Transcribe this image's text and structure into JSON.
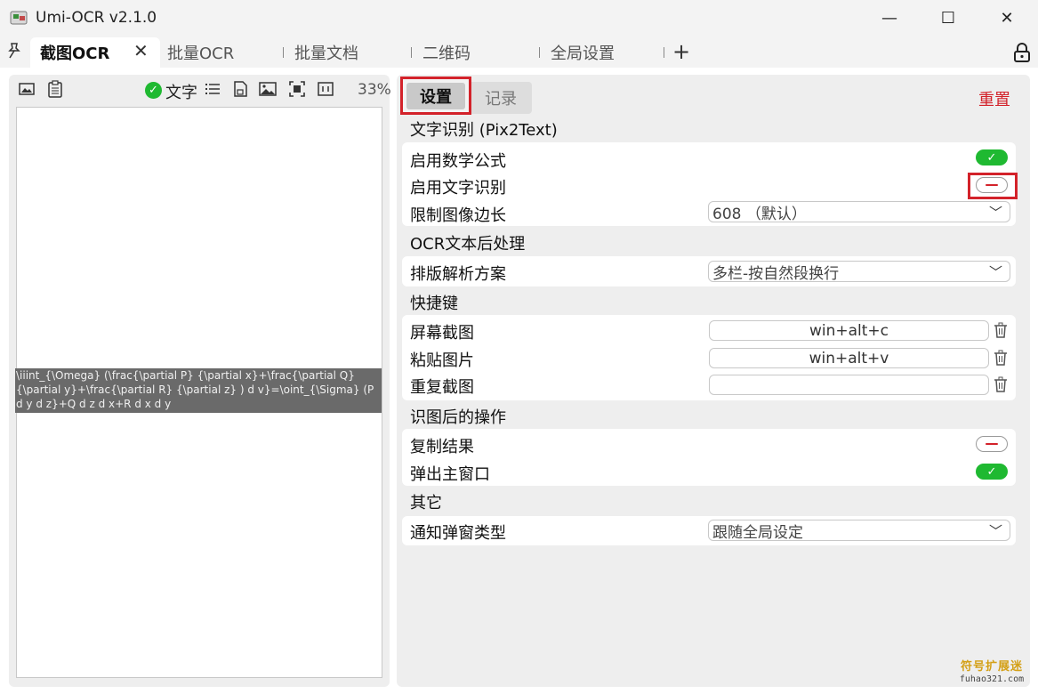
{
  "window": {
    "title": "Umi-OCR v2.1.0",
    "minimize": "—",
    "maximize": "☐",
    "close": "✕"
  },
  "tabs": [
    {
      "label": "截图OCR"
    },
    {
      "label": "批量OCR"
    },
    {
      "label": "批量文档"
    },
    {
      "label": "二维码"
    },
    {
      "label": "全局设置"
    }
  ],
  "tab_close": "✕",
  "tab_add": "+",
  "left": {
    "text_toggle_label": "文字",
    "zoom": "33%",
    "ocr_result": "\\iiint_{\\Omega} (\\frac{\\partial P} {\\partial x}+\\frac{\\partial Q} {\\partial y}+\\frac{\\partial R} {\\partial z} ) d v}=\\oint_{\\Sigma} (P d y d z}+Q d z d x+R d x d y"
  },
  "right": {
    "seg_settings": "设置",
    "seg_log": "记录",
    "reset": "重置",
    "sections": {
      "text_recog": "文字识别 (Pix2Text)",
      "postprocess": "OCR文本后处理",
      "hotkeys": "快捷键",
      "after_ocr": "识图后的操作",
      "other": "其它"
    },
    "rows": {
      "enable_math": "启用数学公式",
      "enable_text": "启用文字识别",
      "limit_size": "限制图像边长",
      "limit_size_value": "608 （默认）",
      "layout_scheme": "排版解析方案",
      "layout_scheme_value": "多栏-按自然段换行",
      "screenshot": "屏幕截图",
      "screenshot_key": "win+alt+c",
      "paste_image": "粘贴图片",
      "paste_key": "win+alt+v",
      "repeat_shot": "重复截图",
      "repeat_key": "",
      "copy_result": "复制结果",
      "popup_main": "弹出主窗口",
      "notify_type": "通知弹窗类型",
      "notify_type_value": "跟随全局设定"
    },
    "toggles": {
      "enable_math": true,
      "enable_text": false,
      "copy_result": false,
      "popup_main": true
    }
  },
  "watermark": {
    "cn": "符号扩展迷",
    "url": "fuhao321.com"
  },
  "colors": {
    "accent_red": "#d3222a",
    "toggle_on": "#1fb931",
    "panel_bg": "#eeeeee"
  }
}
